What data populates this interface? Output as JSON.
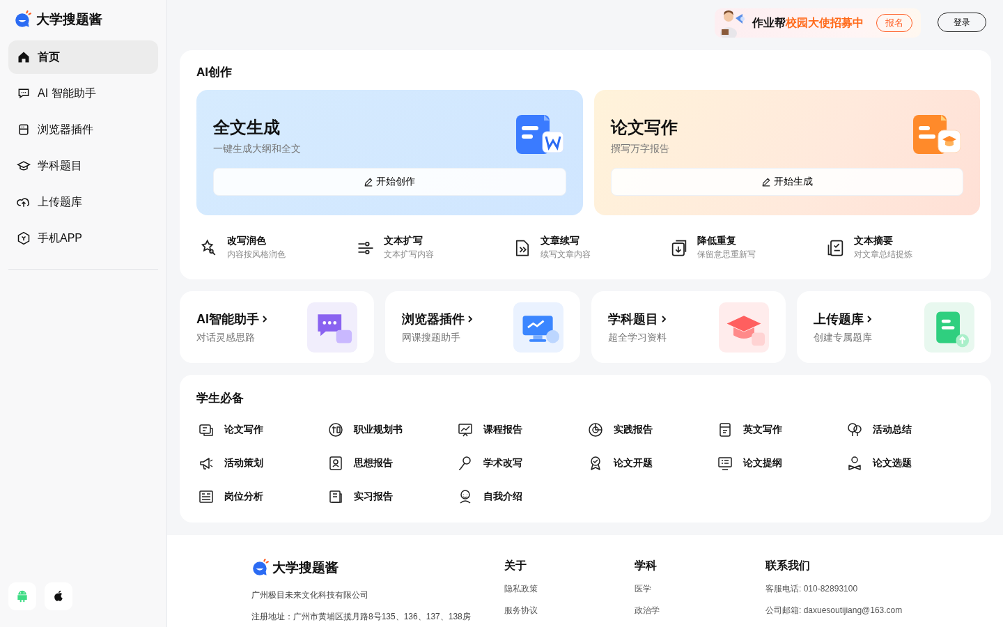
{
  "sidebar": {
    "logo": "大学搜题酱",
    "items": [
      {
        "label": "首页",
        "kind": "home",
        "selected": true
      },
      {
        "label": "AI 智能助手",
        "kind": "chat",
        "selected": false
      },
      {
        "label": "浏览器插件",
        "kind": "browser",
        "selected": false
      },
      {
        "label": "学科题目",
        "kind": "cap",
        "selected": false
      },
      {
        "label": "上传题库",
        "kind": "upload",
        "selected": false
      },
      {
        "label": "手机APP",
        "kind": "hex",
        "selected": false
      }
    ]
  },
  "header": {
    "promo": {
      "text": "作业帮",
      "highlight": "校园大使招募中",
      "button": "报名"
    },
    "login": "登录"
  },
  "ai_creation": {
    "title": "AI创作",
    "feature_cards": [
      {
        "kind": "blue",
        "title": "全文生成",
        "subtitle": "一键生成大纲和全文",
        "button": "开始创作"
      },
      {
        "kind": "orange",
        "title": "论文写作",
        "subtitle": "撰写万字报告",
        "button": "开始生成"
      }
    ],
    "tools": [
      {
        "title": "改写润色",
        "subtitle": "内容按风格润色"
      },
      {
        "title": "文本扩写",
        "subtitle": "文本扩写内容"
      },
      {
        "title": "文章续写",
        "subtitle": "续写文章内容"
      },
      {
        "title": "降低重复",
        "subtitle": "保留意思重新写"
      },
      {
        "title": "文本摘要",
        "subtitle": "对文章总结提炼"
      }
    ]
  },
  "shortcuts": [
    {
      "kind": "chat",
      "title": "AI智能助手",
      "subtitle": "对话灵感思路"
    },
    {
      "kind": "monitor",
      "title": "浏览器插件",
      "subtitle": "网课搜题助手"
    },
    {
      "kind": "cap",
      "title": "学科题目",
      "subtitle": "超全学习资料"
    },
    {
      "kind": "upload",
      "title": "上传题库",
      "subtitle": "创建专属题库"
    }
  ],
  "essentials": {
    "title": "学生必备",
    "items": [
      "论文写作",
      "职业规划书",
      "课程报告",
      "实践报告",
      "英文写作",
      "活动总结",
      "活动策划",
      "思想报告",
      "学术改写",
      "论文开题",
      "论文提纲",
      "论文选题",
      "岗位分析",
      "实习报告",
      "自我介绍"
    ]
  },
  "footer": {
    "logo": "大学搜题酱",
    "company": "广州极目未来文化科技有限公司",
    "address": "注册地址：广州市黄埔区揽月路8号135、136、137、138房",
    "columns": [
      {
        "title": "关于",
        "links": [
          "隐私政策",
          "服务协议"
        ]
      },
      {
        "title": "学科",
        "links": [
          "医学",
          "政治学"
        ]
      },
      {
        "title": "联系我们",
        "links": [
          "客服电话: 010-82893100",
          "公司邮箱: daxuesoutijiang@163.com"
        ]
      }
    ]
  }
}
